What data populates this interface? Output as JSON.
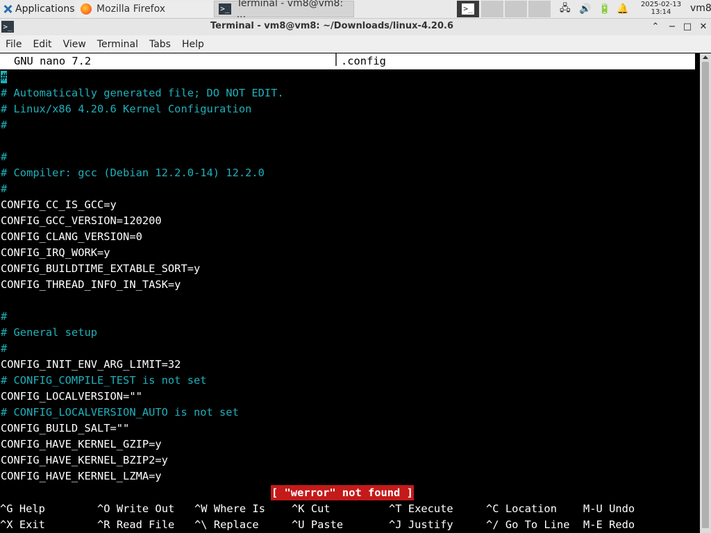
{
  "panel": {
    "apps_label": "Applications",
    "tasks": [
      {
        "label": "Mozilla Firefox"
      },
      {
        "label": "Terminal - vm8@vm8: ..."
      }
    ],
    "clock_date": "2025-02-13",
    "clock_time": "13:14",
    "user": "vm8"
  },
  "window": {
    "title": "Terminal - vm8@vm8: ~/Downloads/linux-4.20.6",
    "buttons": {
      "up": "⌃",
      "min": "−",
      "max": "□",
      "close": "✕"
    }
  },
  "menubar": {
    "items": [
      "File",
      "Edit",
      "View",
      "Terminal",
      "Tabs",
      "Help"
    ]
  },
  "nano": {
    "version": "GNU nano 7.2",
    "filename": ".config",
    "cursor_char": "#",
    "lines": [
      {
        "text": "# Automatically generated file; DO NOT EDIT.",
        "comment": true
      },
      {
        "text": "# Linux/x86 4.20.6 Kernel Configuration",
        "comment": true
      },
      {
        "text": "#",
        "comment": true
      },
      {
        "text": "",
        "comment": false
      },
      {
        "text": "#",
        "comment": true
      },
      {
        "text": "# Compiler: gcc (Debian 12.2.0-14) 12.2.0",
        "comment": true
      },
      {
        "text": "#",
        "comment": true
      },
      {
        "text": "CONFIG_CC_IS_GCC=y",
        "comment": false
      },
      {
        "text": "CONFIG_GCC_VERSION=120200",
        "comment": false
      },
      {
        "text": "CONFIG_CLANG_VERSION=0",
        "comment": false
      },
      {
        "text": "CONFIG_IRQ_WORK=y",
        "comment": false
      },
      {
        "text": "CONFIG_BUILDTIME_EXTABLE_SORT=y",
        "comment": false
      },
      {
        "text": "CONFIG_THREAD_INFO_IN_TASK=y",
        "comment": false
      },
      {
        "text": "",
        "comment": false
      },
      {
        "text": "#",
        "comment": true
      },
      {
        "text": "# General setup",
        "comment": true
      },
      {
        "text": "#",
        "comment": true
      },
      {
        "text": "CONFIG_INIT_ENV_ARG_LIMIT=32",
        "comment": false
      },
      {
        "text": "# CONFIG_COMPILE_TEST is not set",
        "comment": true
      },
      {
        "text": "CONFIG_LOCALVERSION=\"\"",
        "comment": false
      },
      {
        "text": "# CONFIG_LOCALVERSION_AUTO is not set",
        "comment": true
      },
      {
        "text": "CONFIG_BUILD_SALT=\"\"",
        "comment": false
      },
      {
        "text": "CONFIG_HAVE_KERNEL_GZIP=y",
        "comment": false
      },
      {
        "text": "CONFIG_HAVE_KERNEL_BZIP2=y",
        "comment": false
      },
      {
        "text": "CONFIG_HAVE_KERNEL_LZMA=y",
        "comment": false
      }
    ],
    "status_message": "[ \"werror\" not found ]",
    "shortcuts_row1": [
      {
        "key": "^G",
        "label": "Help"
      },
      {
        "key": "^O",
        "label": "Write Out"
      },
      {
        "key": "^W",
        "label": "Where Is"
      },
      {
        "key": "^K",
        "label": "Cut"
      },
      {
        "key": "^T",
        "label": "Execute"
      },
      {
        "key": "^C",
        "label": "Location"
      },
      {
        "key": "M-U",
        "label": "Undo"
      }
    ],
    "shortcuts_row2": [
      {
        "key": "^X",
        "label": "Exit"
      },
      {
        "key": "^R",
        "label": "Read File"
      },
      {
        "key": "^\\",
        "label": "Replace"
      },
      {
        "key": "^U",
        "label": "Paste"
      },
      {
        "key": "^J",
        "label": "Justify"
      },
      {
        "key": "^/",
        "label": "Go To Line"
      },
      {
        "key": "M-E",
        "label": "Redo"
      }
    ]
  },
  "colors": {
    "comment": "#1eb1bb",
    "status_bg": "#c41a1a",
    "header_bg": "#ffffff"
  }
}
